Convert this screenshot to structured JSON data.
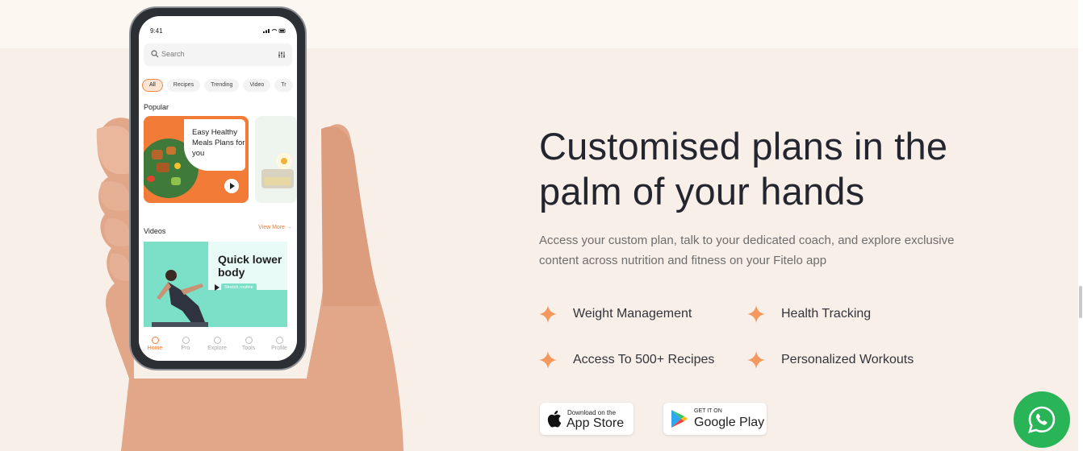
{
  "phone": {
    "status_time": "9:41",
    "search_placeholder": "Search",
    "chips": [
      "All",
      "Recipes",
      "Trending",
      "Video",
      "Tr"
    ],
    "section_popular": "Popular",
    "card_title": "Easy Healthy Meals Plans for you",
    "section_videos": "Videos",
    "view_more": "View More →",
    "video_title": "Quick lower body",
    "video_badge": "Stretch routine",
    "tabs": [
      "Home",
      "Pro",
      "Explore",
      "Tools",
      "Profile"
    ]
  },
  "hero": {
    "headline": "Customised plans in the palm of your hands",
    "description": "Access your custom plan, talk to your dedicated coach, and explore exclusive content across nutrition and fitness on your Fitelo app"
  },
  "features": [
    "Weight Management",
    "Health Tracking",
    "Access To 500+ Recipes",
    "Personalized Workouts"
  ],
  "stores": {
    "apple_small": "Download on the",
    "apple_big": "App Store",
    "google_small": "GET IT ON",
    "google_big": "Google Play"
  },
  "colors": {
    "accent": "#f07b35",
    "headline": "#23252f",
    "background": "#f8efe9",
    "whatsapp": "#29b457"
  }
}
